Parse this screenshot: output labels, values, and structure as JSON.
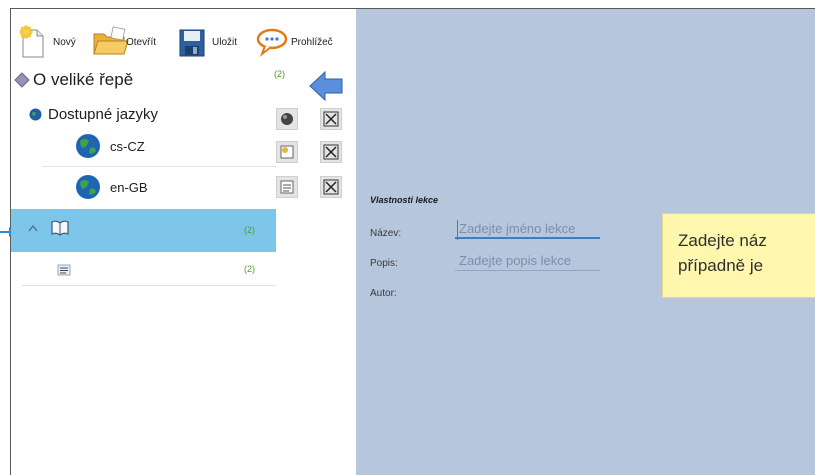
{
  "toolbar": {
    "new_label": "Nový",
    "open_label": "Otevřít",
    "save_label": "Uložit",
    "browser_label": "Prohlížeč"
  },
  "tree": {
    "root_label": "O veliké řepě",
    "root_count": "(2)",
    "languages_label": "Dostupné jazyky",
    "languages": [
      {
        "code": "cs-CZ"
      },
      {
        "code": "en-GB"
      }
    ],
    "selected_count": "(2)",
    "child_count": "(2)"
  },
  "properties": {
    "title": "Vlastnosti lekce",
    "name_label": "Název:",
    "name_placeholder": "Zadejte jméno lekce",
    "description_label": "Popis:",
    "description_placeholder": "Zadejte popis lekce",
    "author_label": "Autor:"
  },
  "tooltip": {
    "line1": "Zadejte náz",
    "line2": "případně je"
  },
  "colors": {
    "right_panel": "#b6c6dc",
    "selection": "#7ec5ea",
    "count_green": "#4a9b2c",
    "tooltip_bg": "#fef7ad"
  }
}
